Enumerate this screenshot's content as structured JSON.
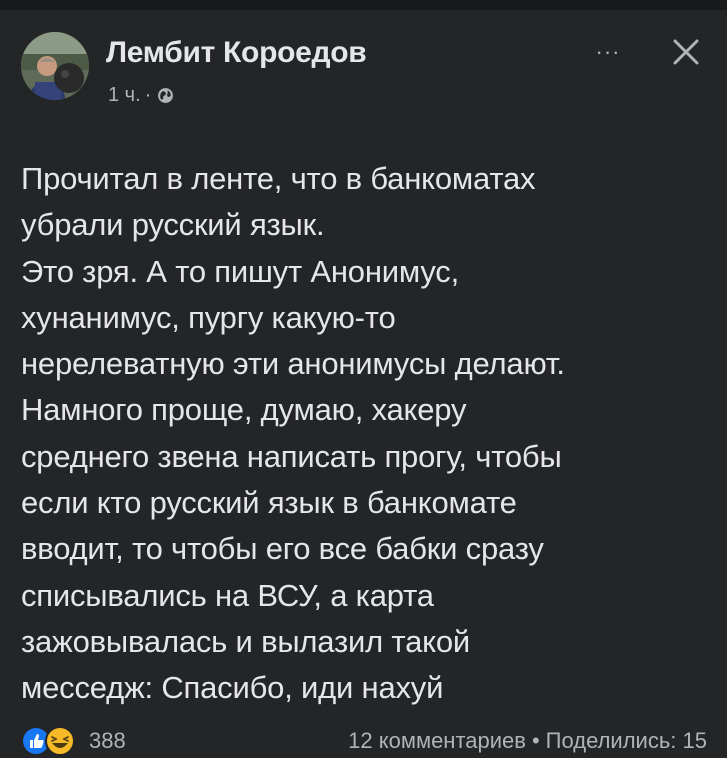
{
  "post": {
    "author_name": "Лембит Короедов",
    "time_ago": "1 ч.",
    "meta_separator": "·",
    "privacy_icon": "globe-icon",
    "more_label": "···",
    "close_icon": "close-icon",
    "text": "Прочитал в ленте, что в банкоматах\nубрали русский язык.\nЭто зря. А то пишут Анонимус,\nхунанимус, пургу какую-то\nнерелеватную эти анонимусы делают.\nНамного проще, думаю, хакеру\nсреднего звена написать прогу, чтобы\nесли кто русский язык в банкомате\nвводит, то чтобы его все бабки сразу\nсписывались на ВСУ, а карта\nзажовывалась и вылазил такой\nмесседж: Спасибо, иди нахуй"
  },
  "footer": {
    "reaction_icons": [
      "like-icon",
      "haha-icon"
    ],
    "reaction_count": "388",
    "comments": "12 комментариев",
    "dot": "•",
    "shares": "Поделились: 15"
  },
  "colors": {
    "background": "#242526",
    "primary_text": "#e4e6eb",
    "secondary_text": "#b0b3b8",
    "like_blue": "#1877f2",
    "haha_yellow": "#f7b928"
  }
}
